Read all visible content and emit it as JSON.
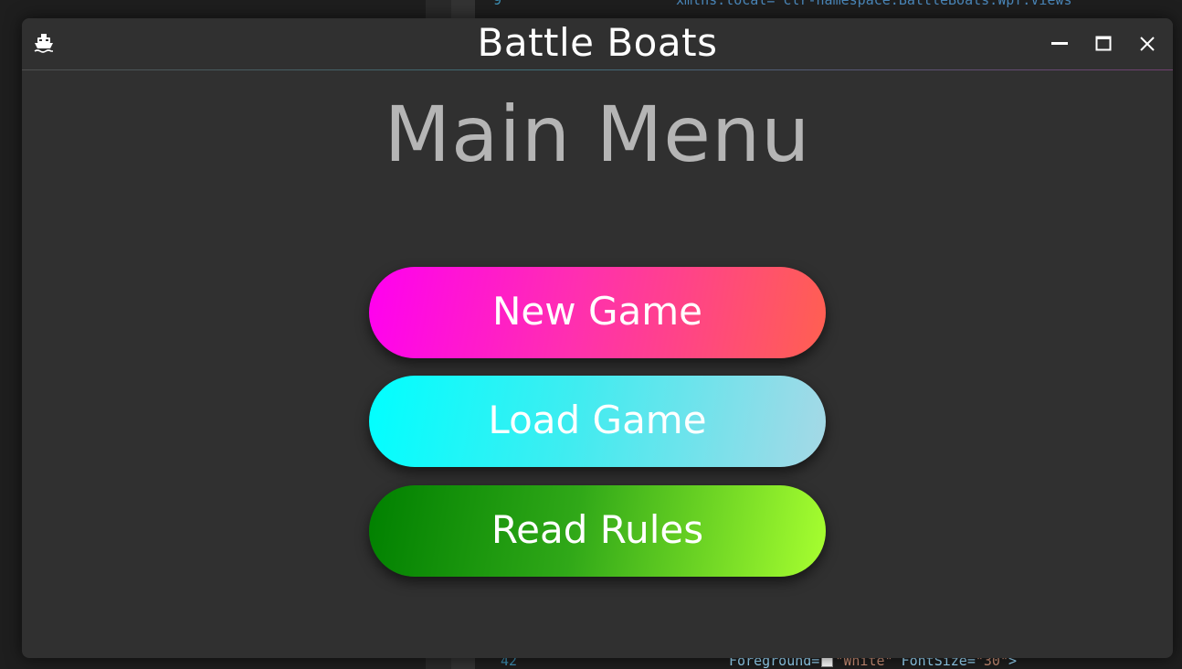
{
  "background_ide": {
    "top_line_number": "9",
    "top_code": "xmlns:local=\"clr-namespace:BattleBoats.Wpf.Views\"",
    "bottom_line_number": "42",
    "bottom_code_prefix": "Foreground=",
    "bottom_code_value": "\"White\"",
    "bottom_code_mid": " FontSize=",
    "bottom_code_value2": "\"30\"",
    "bottom_code_suffix": ">"
  },
  "window": {
    "title": "Battle Boats",
    "icon": "ship-icon",
    "controls": {
      "minimize": "minimize-icon",
      "maximize": "maximize-icon",
      "close": "close-icon"
    }
  },
  "main": {
    "heading": "Main Menu",
    "buttons": [
      {
        "label": "New Game",
        "gradient": [
          "#ff00f0",
          "#ff6050"
        ]
      },
      {
        "label": "Load Game",
        "gradient": [
          "#00ffff",
          "#a6d8e6"
        ]
      },
      {
        "label": "Read Rules",
        "gradient": [
          "#008000",
          "#a8ff30"
        ]
      }
    ]
  },
  "colors": {
    "window_bg": "#303030",
    "heading": "#b5b5b5",
    "text": "#ffffff"
  }
}
